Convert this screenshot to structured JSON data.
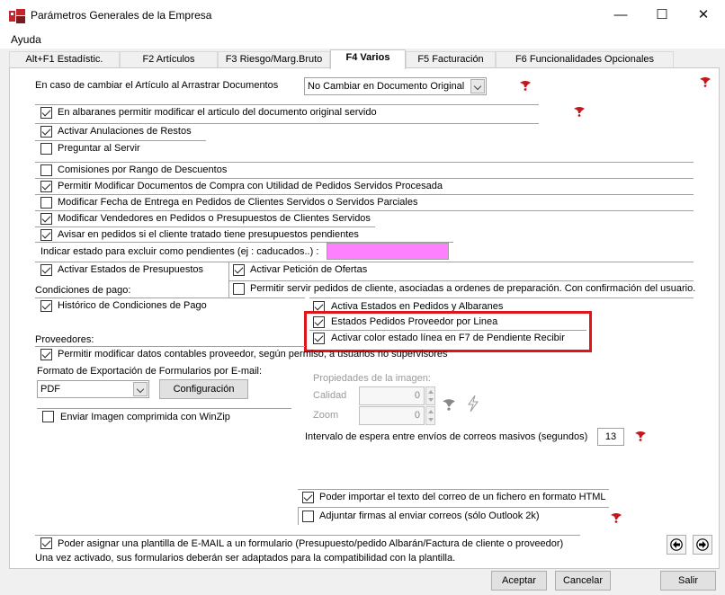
{
  "window": {
    "title": "Parámetros Generales de la Empresa",
    "minimize": "—",
    "maximize": "☐",
    "close": "✕"
  },
  "menu": {
    "help": "Ayuda"
  },
  "tabs": [
    {
      "label": "Alt+F1 Estadístic."
    },
    {
      "label": "F2 Artículos"
    },
    {
      "label": "F3 Riesgo/Marg.Bruto"
    },
    {
      "label": "F4 Varios",
      "active": true
    },
    {
      "label": "F5 Facturación"
    },
    {
      "label": "F6 Funcionalidades Opcionales"
    }
  ],
  "article_change": {
    "label": "En caso de cambiar el Artículo al Arrastrar Documentos",
    "value": "No Cambiar en Documento Original"
  },
  "options": {
    "albaranes_modificar": {
      "label": "En albaranes permitir modificar el articulo del documento original servido",
      "checked": true
    },
    "anulaciones_restos": {
      "label": "Activar Anulaciones de Restos",
      "checked": true
    },
    "preguntar_servir": {
      "label": "Preguntar al Servir",
      "checked": false
    },
    "comisiones_rango": {
      "label": "Comisiones por Rango de Descuentos",
      "checked": false
    },
    "modificar_compra": {
      "label": "Permitir Modificar Documentos de Compra con Utilidad de Pedidos Servidos Procesada",
      "checked": true
    },
    "fecha_entrega": {
      "label": "Modificar Fecha de Entrega en Pedidos de Clientes Servidos o Servidos Parciales",
      "checked": false
    },
    "vendedores": {
      "label": "Modificar Vendedores en Pedidos o Presupuestos de Clientes Servidos",
      "checked": true
    },
    "avisar_pedidos": {
      "label": "Avisar en pedidos si el cliente tratado tiene presupuestos pendientes",
      "checked": true
    },
    "estados_presupuestos": {
      "label": "Activar Estados de Presupuestos",
      "checked": true
    },
    "peticion_ofertas": {
      "label": "Activar Petición de Ofertas",
      "checked": true
    },
    "servir_pedidos": {
      "label": "Permitir servir pedidos de cliente, asociadas a ordenes de preparación. Con confirmación del usuario.",
      "checked": false
    },
    "historico_condiciones": {
      "label": "Histórico de Condiciones de Pago",
      "checked": true
    },
    "estados_pedidos_albaranes": {
      "label": "Activa Estados en Pedidos y Albaranes",
      "checked": true
    },
    "estados_proveedor_linea": {
      "label": "Estados Pedidos Proveedor por Linea",
      "checked": true
    },
    "color_f7": {
      "label": "Activar color estado línea en F7 de Pendiente Recibir",
      "checked": true
    },
    "datos_contables": {
      "label": "Permitir modificar datos contables proveedor, según permiso, a usuarios no supervisores",
      "checked": true
    },
    "imagen_winzip": {
      "label": "Enviar Imagen comprimida con WinZip",
      "checked": false
    },
    "importar_html": {
      "label": "Poder importar el texto del correo de un fichero en formato HTML",
      "checked": true
    },
    "firmas_outlook": {
      "label": "Adjuntar firmas al enviar correos (sólo Outlook 2k)",
      "checked": false
    },
    "plantilla_email": {
      "label": "Poder asignar una plantilla de E-MAIL a un formulario (Presupuesto/pedido Albarán/Factura de cliente o proveedor)",
      "checked": true
    }
  },
  "excluir_pendientes": {
    "label": "Indicar estado para excluir como pendientes (ej : caducados..) :"
  },
  "condiciones_pago": {
    "label": "Condiciones de pago:"
  },
  "proveedores": {
    "label": "Proveedores:"
  },
  "formato_exportacion": {
    "label": "Formato de Exportación de Formularios por E-mail:",
    "value": "PDF",
    "config_button": "Configuración"
  },
  "imagen": {
    "title": "Propiedades de la imagen:",
    "calidad_label": "Calidad",
    "calidad_value": "0",
    "zoom_label": "Zoom",
    "zoom_value": "0"
  },
  "intervalo": {
    "label": "Intervalo de espera entre envíos de correos masivos (segundos)",
    "value": "13"
  },
  "plantilla_note": "Una vez activado, sus formularios deberán ser adaptados para la compatibilidad con la plantilla.",
  "footer": {
    "accept": "Aceptar",
    "cancel": "Cancelar",
    "exit": "Salir"
  },
  "colors": {
    "highlight_border": "#e0141b",
    "excluir_estado_fill": "#ff80ff"
  }
}
